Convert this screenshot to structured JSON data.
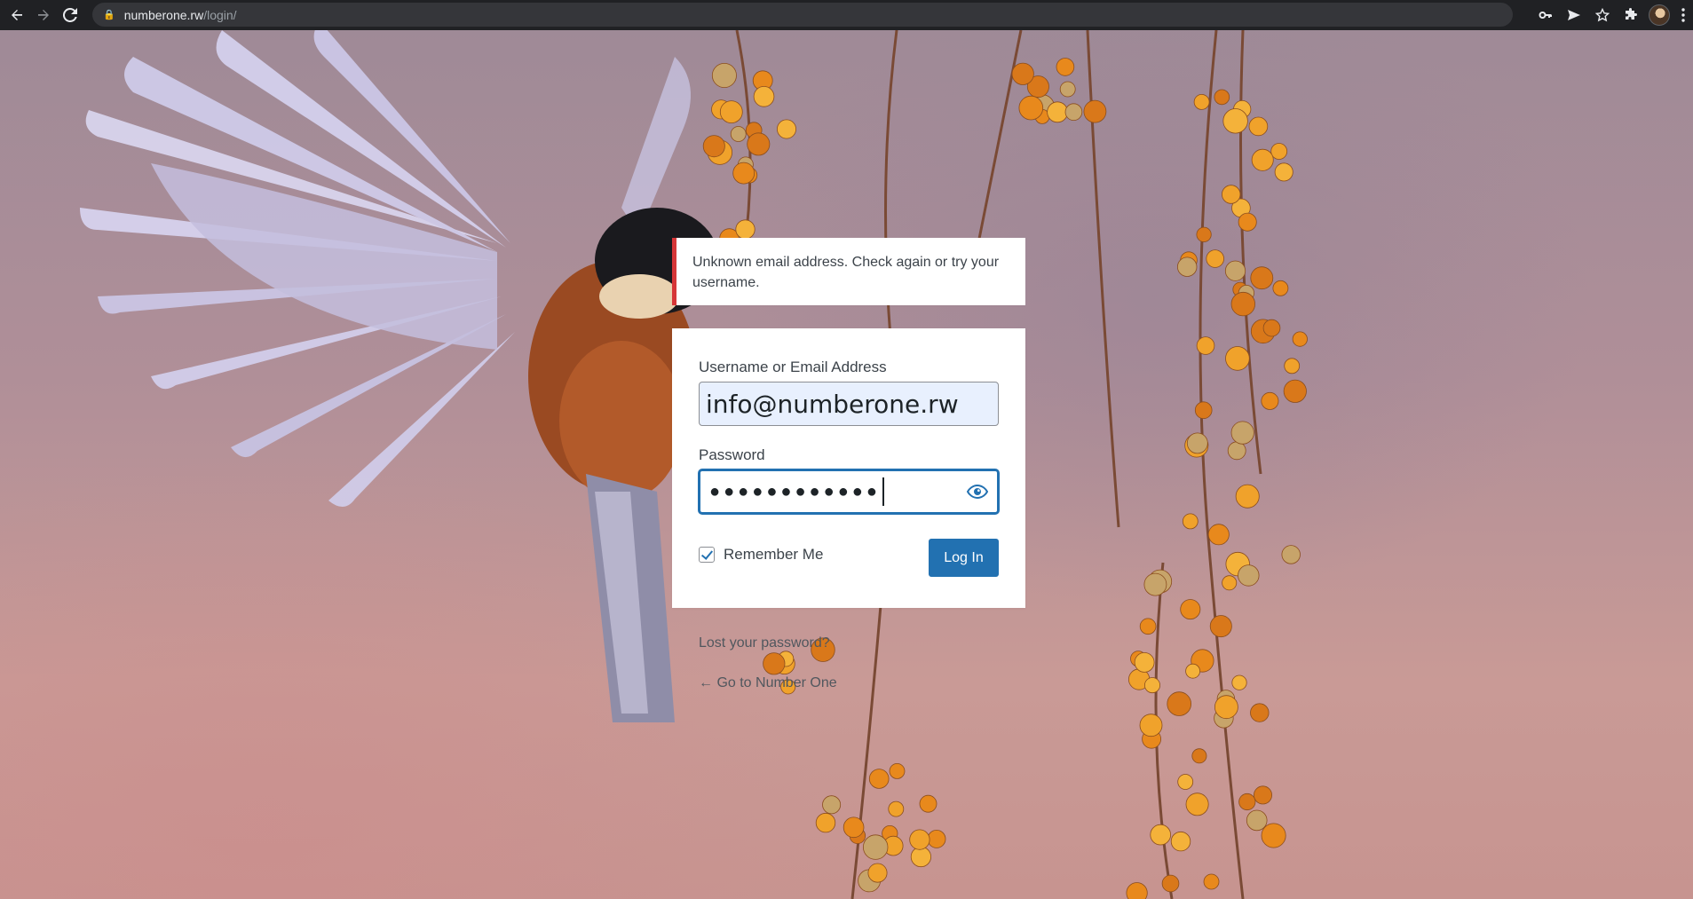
{
  "browser": {
    "url_host": "numberone.rw",
    "url_path": "/login/",
    "back_icon": "arrow-left-icon",
    "forward_icon": "arrow-right-icon",
    "reload_icon": "reload-icon",
    "toolbar_icons": [
      "key-icon",
      "send-icon",
      "star-icon",
      "puzzle-icon",
      "avatar",
      "kebab-menu-icon"
    ]
  },
  "notice": {
    "message": "Unknown email address. Check again or try your username.",
    "accent_color": "#d63638"
  },
  "login": {
    "username_label": "Username or Email Address",
    "username_value": "info@numberone.rw",
    "password_label": "Password",
    "password_masked": "●●●●●●●●●●●●",
    "remember_label": "Remember Me",
    "remember_checked": true,
    "submit_label": "Log In",
    "accent_color": "#2271b1"
  },
  "links": {
    "lost_password": "Lost your password?",
    "back_to_site": "← Go to Number One"
  }
}
